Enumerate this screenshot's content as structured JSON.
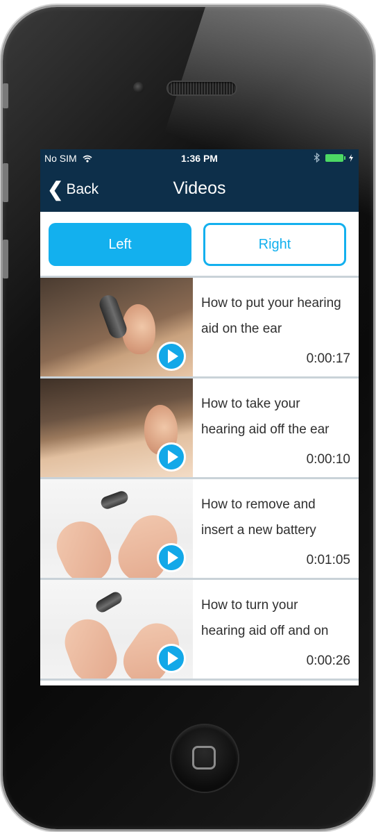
{
  "status_bar": {
    "carrier": "No SIM",
    "time": "1:36 PM",
    "bluetooth_icon": "bluetooth-icon",
    "battery_icon": "battery-icon"
  },
  "nav": {
    "back_label": "Back",
    "title": "Videos"
  },
  "segment": {
    "left_label": "Left",
    "right_label": "Right",
    "selected": "Left"
  },
  "videos": [
    {
      "title": "How to put your hearing aid on the ear",
      "duration": "0:00:17"
    },
    {
      "title": "How to take your hearing aid off the ear",
      "duration": "0:00:10"
    },
    {
      "title": "How to remove and insert a new battery",
      "duration": "0:01:05"
    },
    {
      "title": "How to turn your hearing aid off and on",
      "duration": "0:00:26"
    }
  ],
  "colors": {
    "nav_background": "#0d2f4a",
    "accent": "#13b0ee",
    "play_button": "#13a8e8"
  }
}
